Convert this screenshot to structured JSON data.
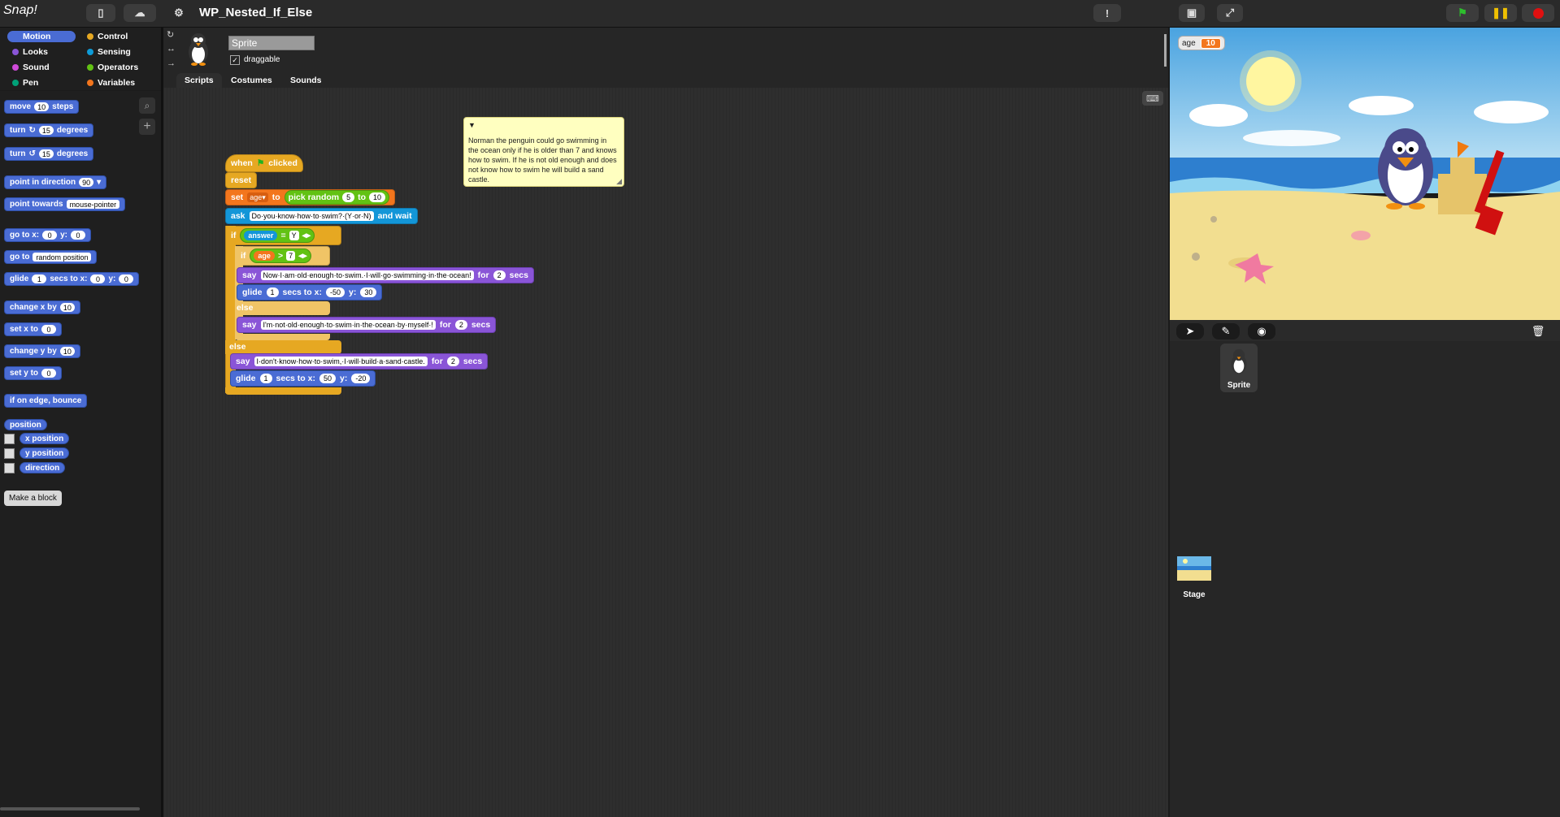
{
  "app": {
    "logo_text": "Snap!",
    "project_title": "WP_Nested_If_Else"
  },
  "topbar": {
    "file_icon": "file-icon",
    "cloud_icon": "cloud-icon",
    "settings_icon": "gear-icon",
    "warning_label": "!",
    "stage_size_icon": "stage-size-icon",
    "fullscreen_icon": "fullscreen-icon"
  },
  "controls": {
    "green_flag": "green-flag-icon",
    "pause": "pause-icon",
    "stop": "stop-icon"
  },
  "categories": [
    {
      "label": "Motion",
      "color": "#4a6cd4",
      "selected": true
    },
    {
      "label": "Control",
      "color": "#e6a822"
    },
    {
      "label": "Looks",
      "color": "#8a55d7"
    },
    {
      "label": "Sensing",
      "color": "#0e9bd8"
    },
    {
      "label": "Sound",
      "color": "#cf4ad9"
    },
    {
      "label": "Operators",
      "color": "#62c213"
    },
    {
      "label": "Pen",
      "color": "#00a178"
    },
    {
      "label": "Variables",
      "color": "#f3761d"
    }
  ],
  "palette": {
    "move": {
      "a": "move",
      "n": "10",
      "b": "steps"
    },
    "turn_cw": {
      "a": "turn",
      "n": "15",
      "b": "degrees"
    },
    "turn_ccw": {
      "a": "turn",
      "n": "15",
      "b": "degrees"
    },
    "point_dir": {
      "a": "point in direction",
      "n": "90"
    },
    "point_towards": {
      "a": "point towards",
      "v": "mouse-pointer"
    },
    "goto_xy": {
      "a": "go to x:",
      "x": "0",
      "b": "y:",
      "y": "0"
    },
    "goto": {
      "a": "go to",
      "v": "random position"
    },
    "glide": {
      "a": "glide",
      "s": "1",
      "b": "secs to x:",
      "x": "0",
      "c": "y:",
      "y": "0"
    },
    "change_x": {
      "a": "change x by",
      "n": "10"
    },
    "set_x": {
      "a": "set x to",
      "n": "0"
    },
    "change_y": {
      "a": "change y by",
      "n": "10"
    },
    "set_y": {
      "a": "set y to",
      "n": "0"
    },
    "bounce": "if on edge, bounce",
    "position": "position",
    "x_position": "x position",
    "y_position": "y position",
    "direction": "direction",
    "make_block": "Make a block"
  },
  "sprite": {
    "name": "Sprite",
    "draggable_label": "draggable",
    "draggable_checked": "✓"
  },
  "tabs": [
    "Scripts",
    "Costumes",
    "Sounds"
  ],
  "note": "Norman the penguin could go swimming in the ocean only if he is older than 7 and knows how to swim. If he is not old enough and does not know how to swim he will build a sand castle.",
  "script": {
    "hat": {
      "when": "when",
      "clicked": "clicked"
    },
    "reset": "reset",
    "set": {
      "a": "set",
      "var": "age",
      "to": "to",
      "pick": "pick random",
      "lo": "5",
      "to2": "to",
      "hi": "10"
    },
    "ask": {
      "a": "ask",
      "q": "Do·you·know·how·to·swim?·(Y·or·N)",
      "b": "and wait"
    },
    "if1": {
      "a": "if",
      "answer": "answer",
      "eq": "=",
      "val": "Y"
    },
    "if2": {
      "a": "if",
      "age": "age",
      "gt": ">",
      "val": "7"
    },
    "say1": {
      "a": "say",
      "msg": "Now·I·am·old·enough·to·swim.·I·will·go·swimming·in·the·ocean!",
      "for": "for",
      "n": "2",
      "secs": "secs"
    },
    "glide1": {
      "a": "glide",
      "s": "1",
      "b": "secs to x:",
      "x": "-50",
      "c": "y:",
      "y": "30"
    },
    "else1": "else",
    "say2": {
      "a": "say",
      "msg": "I'm·not·old·enough·to·swim·in·the·ocean·by·myself·!",
      "for": "for",
      "n": "2",
      "secs": "secs"
    },
    "else2": "else",
    "say3": {
      "a": "say",
      "msg": "I·don't·know·how·to·swim,·I·will·build·a·sand·castle.",
      "for": "for",
      "n": "2",
      "secs": "secs"
    },
    "glide2": {
      "a": "glide",
      "s": "1",
      "b": "secs to x:",
      "x": "50",
      "c": "y:",
      "y": "-20"
    }
  },
  "watcher": {
    "label": "age",
    "value": "10"
  },
  "corral": {
    "sprite_label": "Sprite",
    "stage_label": "Stage"
  }
}
